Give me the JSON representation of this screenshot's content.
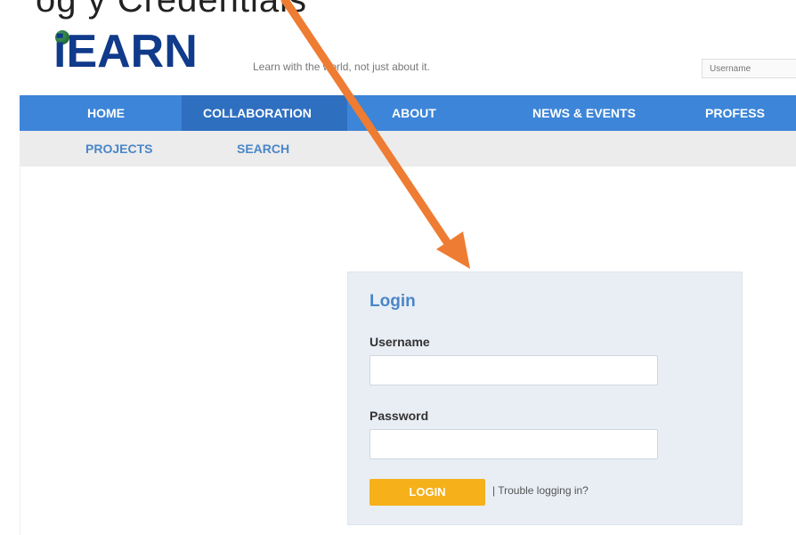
{
  "overlay": {
    "caption": "og y  Credentials"
  },
  "header": {
    "logo_text": "iEARN",
    "tagline": "Learn with the world, not just about it.",
    "username_placeholder": "Username"
  },
  "nav": {
    "items": [
      {
        "label": "HOME"
      },
      {
        "label": "COLLABORATION"
      },
      {
        "label": "ABOUT"
      },
      {
        "label": "NEWS & EVENTS"
      },
      {
        "label": "PROFESS"
      }
    ]
  },
  "subnav": {
    "items": [
      {
        "label": "PROJECTS"
      },
      {
        "label": "SEARCH"
      }
    ]
  },
  "login": {
    "title": "Login",
    "username_label": "Username",
    "username_value": "",
    "password_label": "Password",
    "password_value": "",
    "button_label": "LOGIN",
    "trouble_link": "| Trouble logging in?"
  },
  "colors": {
    "nav_bg": "#3d85d8",
    "nav_active_bg": "#2f6fc0",
    "accent": "#4a86c8",
    "button": "#f6b01a",
    "arrow": "#ee7c32",
    "logo": "#103a8a"
  }
}
